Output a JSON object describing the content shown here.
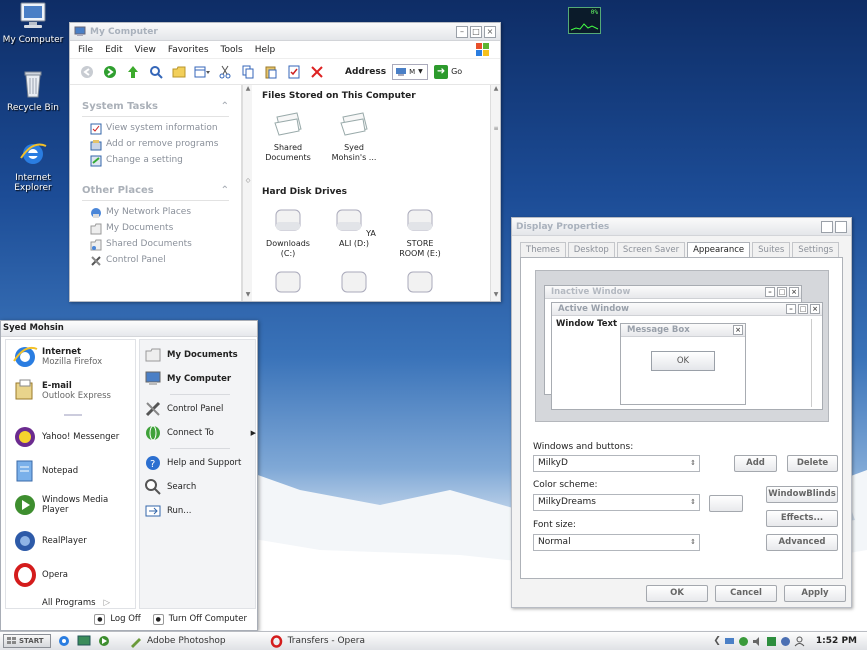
{
  "desktop": {
    "icons": [
      {
        "label": "My Computer"
      },
      {
        "label": "Recycle Bin"
      },
      {
        "label": "Internet Explorer"
      }
    ],
    "cpu_meter": "0%"
  },
  "mycomputer": {
    "title": "My Computer",
    "menu": [
      "File",
      "Edit",
      "View",
      "Favorites",
      "Tools",
      "Help"
    ],
    "address_label": "Address",
    "address_value": "M",
    "go_label": "Go",
    "tasks": {
      "system_title": "System Tasks",
      "system_items": [
        "View system information",
        "Add or remove programs",
        "Change a setting"
      ],
      "places_title": "Other Places",
      "places_items": [
        "My Network Places",
        "My Documents",
        "Shared Documents",
        "Control Panel"
      ]
    },
    "files_title": "Files Stored on This Computer",
    "folders": [
      "Shared Documents",
      "Syed Mohsin's ..."
    ],
    "drives_title": "Hard Disk Drives",
    "drives": [
      "Downloads (C:)",
      "YA ALI (D:)",
      "STORE ROOM (E:)"
    ]
  },
  "display": {
    "title": "Display Properties",
    "tabs": [
      "Themes",
      "Desktop",
      "Screen Saver",
      "Appearance",
      "Suites",
      "Settings"
    ],
    "active_tab": "Appearance",
    "preview": {
      "inactive": "Inactive Window",
      "active": "Active Window",
      "window_text": "Window Text",
      "msgbox": "Message Box",
      "ok": "OK"
    },
    "windows_label": "Windows and buttons:",
    "windows_value": "MilkyD",
    "scheme_label": "Color scheme:",
    "scheme_value": "MilkyDreams",
    "font_label": "Font size:",
    "font_value": "Normal",
    "btn_add": "Add",
    "btn_delete": "Delete",
    "btn_windowblinds": "WindowBlinds",
    "btn_effects": "Effects...",
    "btn_advanced": "Advanced",
    "btn_ok": "OK",
    "btn_cancel": "Cancel",
    "btn_apply": "Apply"
  },
  "startmenu": {
    "user": "Syed Mohsin",
    "pinned": [
      {
        "title": "Internet",
        "sub": "Mozilla Firefox"
      },
      {
        "title": "E-mail",
        "sub": "Outlook Express"
      }
    ],
    "recent": [
      "Yahoo! Messenger",
      "Notepad",
      "Windows Media Player",
      "RealPlayer",
      "Opera"
    ],
    "all_programs": "All Programs",
    "right": [
      "My Documents",
      "My Computer",
      "Control Panel",
      "Connect To",
      "Help and Support",
      "Search",
      "Run..."
    ],
    "logoff": "Log Off",
    "turnoff": "Turn Off Computer"
  },
  "taskbar": {
    "start": "START",
    "tasks": [
      "Adobe Photoshop",
      "Transfers - Opera"
    ],
    "clock": "1:52 PM"
  }
}
